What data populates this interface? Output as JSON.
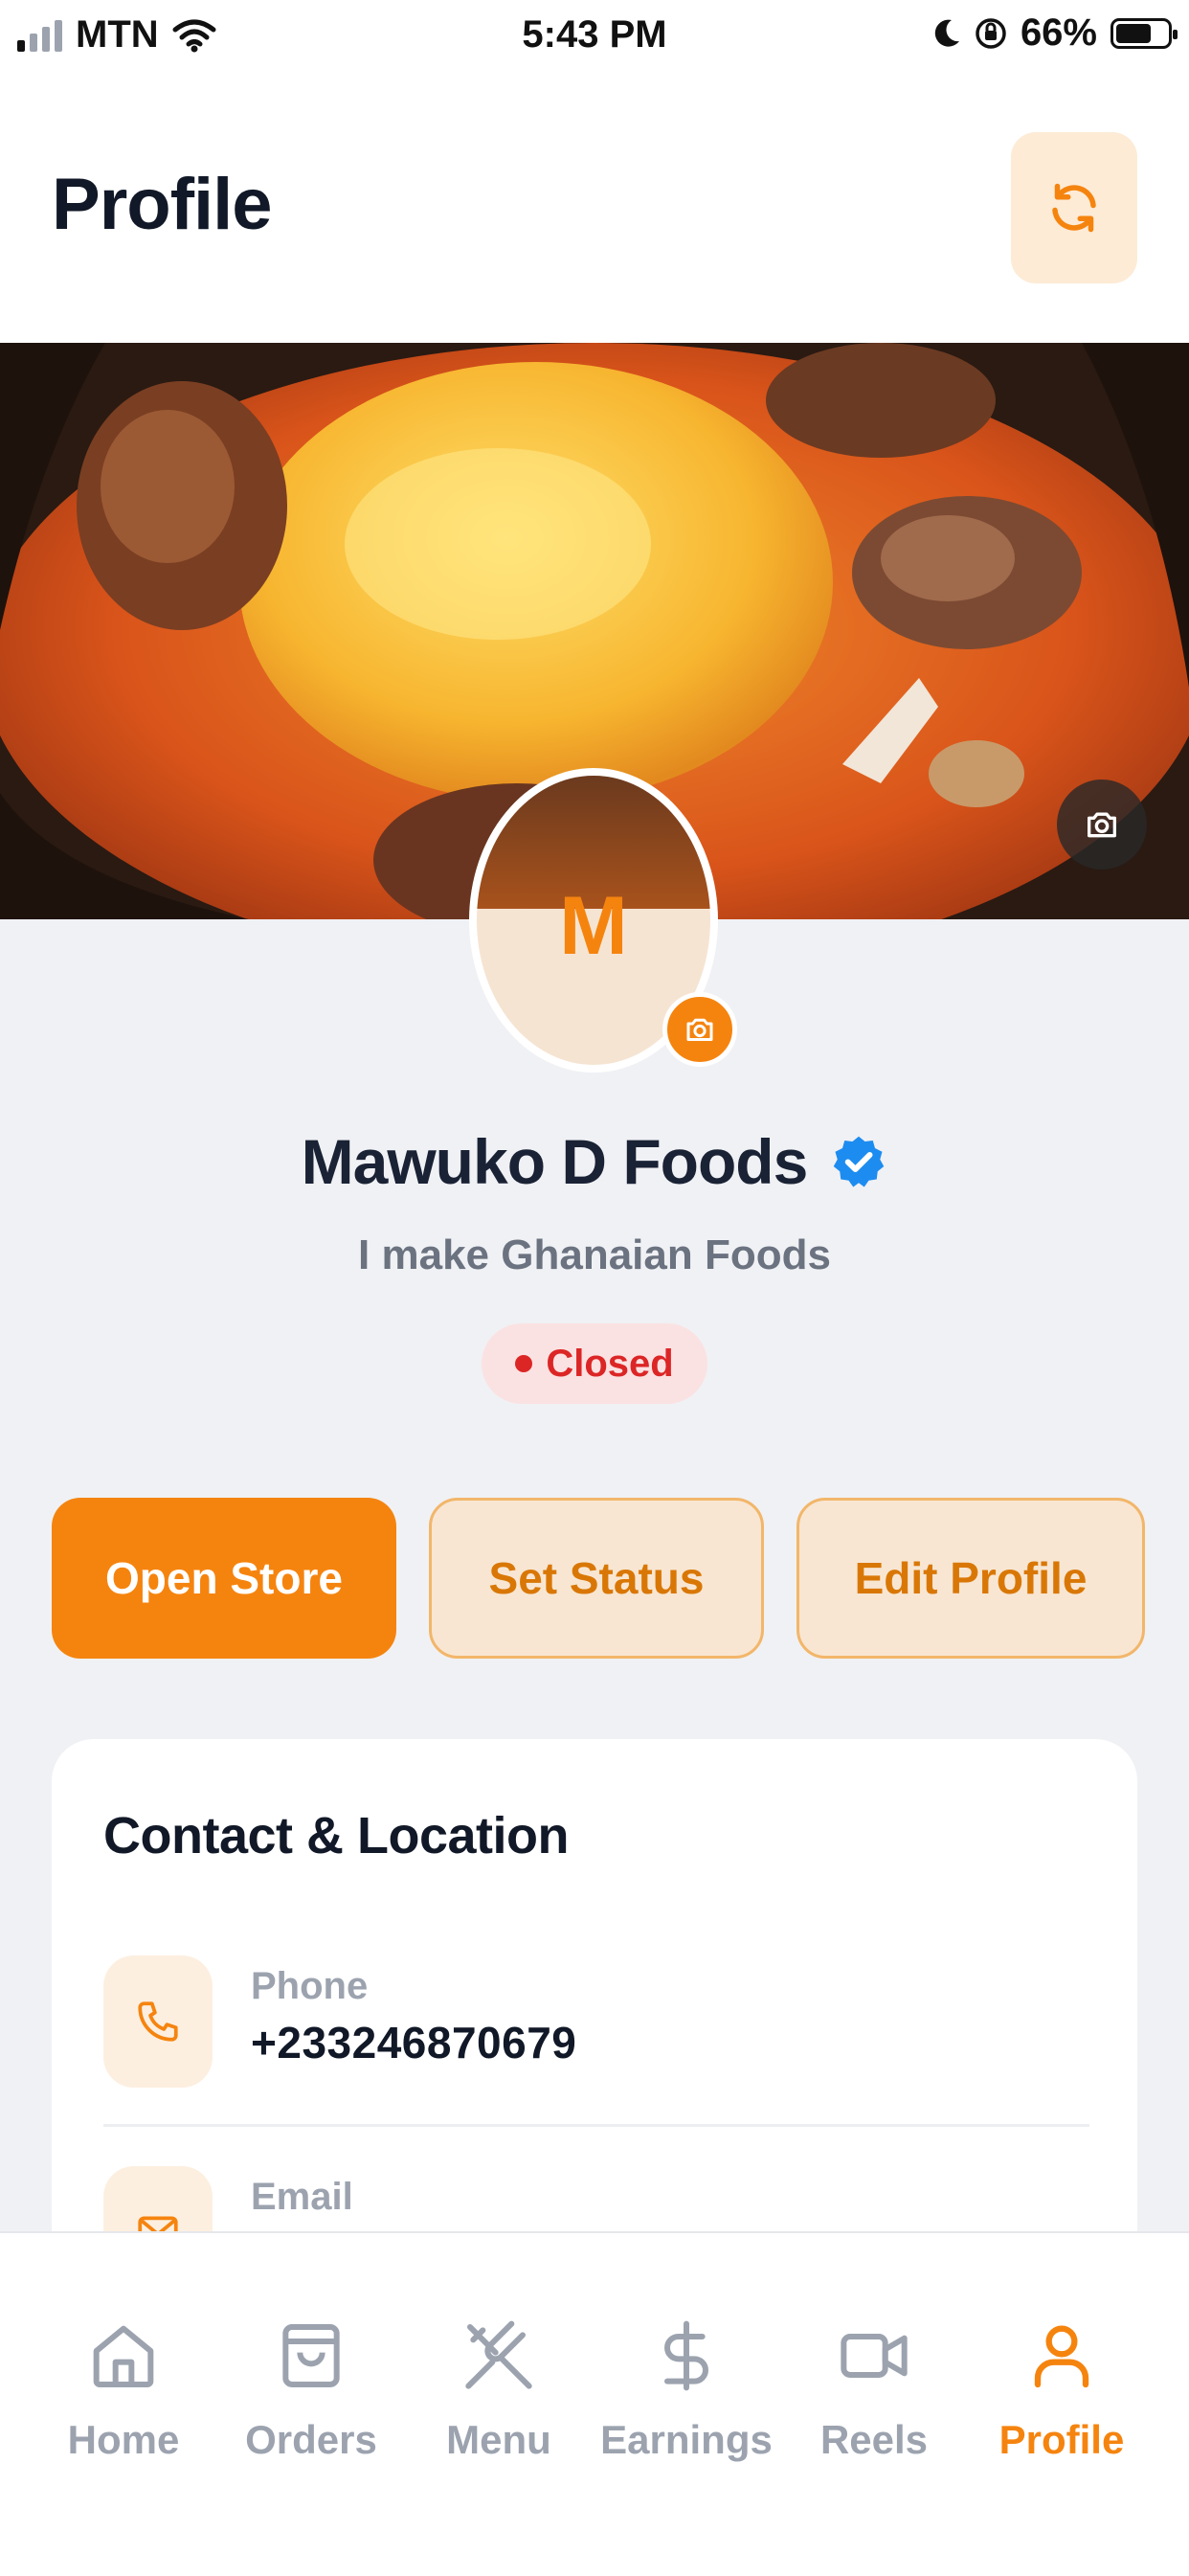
{
  "status_bar": {
    "carrier": "MTN",
    "time": "5:43 PM",
    "battery": "66%",
    "battery_level": 0.66
  },
  "header": {
    "title": "Profile",
    "refresh_icon": "refresh-icon"
  },
  "profile": {
    "avatar_letter": "M",
    "name": "Mawuko D Foods",
    "verified": true,
    "tagline": "I make Ghanaian Foods",
    "status": "Closed",
    "status_color": "#dc2626"
  },
  "actions": {
    "open_store": "Open Store",
    "set_status": "Set Status",
    "edit_profile": "Edit Profile"
  },
  "contact": {
    "title": "Contact & Location",
    "items": [
      {
        "label": "Phone",
        "value": "+233246870679",
        "icon": "phone-icon"
      },
      {
        "label": "Email",
        "value": "",
        "icon": "mail-icon"
      }
    ]
  },
  "bottom_nav": {
    "items": [
      {
        "label": "Home",
        "icon": "home-icon",
        "active": false
      },
      {
        "label": "Orders",
        "icon": "bag-icon",
        "active": false
      },
      {
        "label": "Menu",
        "icon": "utensils-icon",
        "active": false
      },
      {
        "label": "Earnings",
        "icon": "dollar-icon",
        "active": false
      },
      {
        "label": "Reels",
        "icon": "video-icon",
        "active": false
      },
      {
        "label": "Profile",
        "icon": "user-icon",
        "active": true
      }
    ]
  },
  "colors": {
    "accent": "#f5840f",
    "accent_soft": "#f8e6d2",
    "background": "#f0f1f4",
    "verified_blue": "#1d8cf0"
  }
}
